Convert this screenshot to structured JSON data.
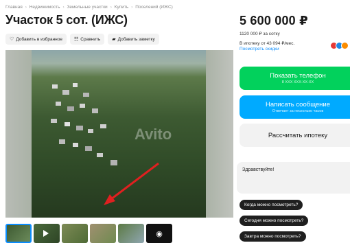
{
  "breadcrumb": [
    "Главная",
    "Недвижимость",
    "Земельные участки",
    "Купить",
    "Поселений (ИЖС)"
  ],
  "title": "Участок 5 сот. (ИЖС)",
  "actions": {
    "favorite": "Добавить в избранное",
    "compare": "Сравнить",
    "note": "Добавить заметку"
  },
  "photo": {
    "watermark": "Avito"
  },
  "price": {
    "main": "5 600 000 ₽",
    "per_sotka": "1120 000 ₽ за сотку",
    "mortgage": "В ипотеку от 43 094 ₽/мес.",
    "discounts_link": "Посмотреть скидки"
  },
  "buttons": {
    "phone_label": "Показать телефон",
    "phone_sub": "8 XXX XXX-XX-XX",
    "message_label": "Написать сообщение",
    "message_sub": "Отвечает за несколько часов",
    "mortgage_label": "Рассчитать ипотеку"
  },
  "chat": {
    "greeting": "Здравствуйте!"
  },
  "quick_questions": [
    "Когда можно посмотреть?",
    "Сегодня можно посмотреть?",
    "Завтра можно посмотреть?"
  ],
  "thumbs_more_icon": "camera-icon",
  "colors": {
    "phone_button": "#02d15c",
    "message_button": "#00aaff",
    "link": "#0a8cfd",
    "quick_chip": "#1f1f1f"
  }
}
